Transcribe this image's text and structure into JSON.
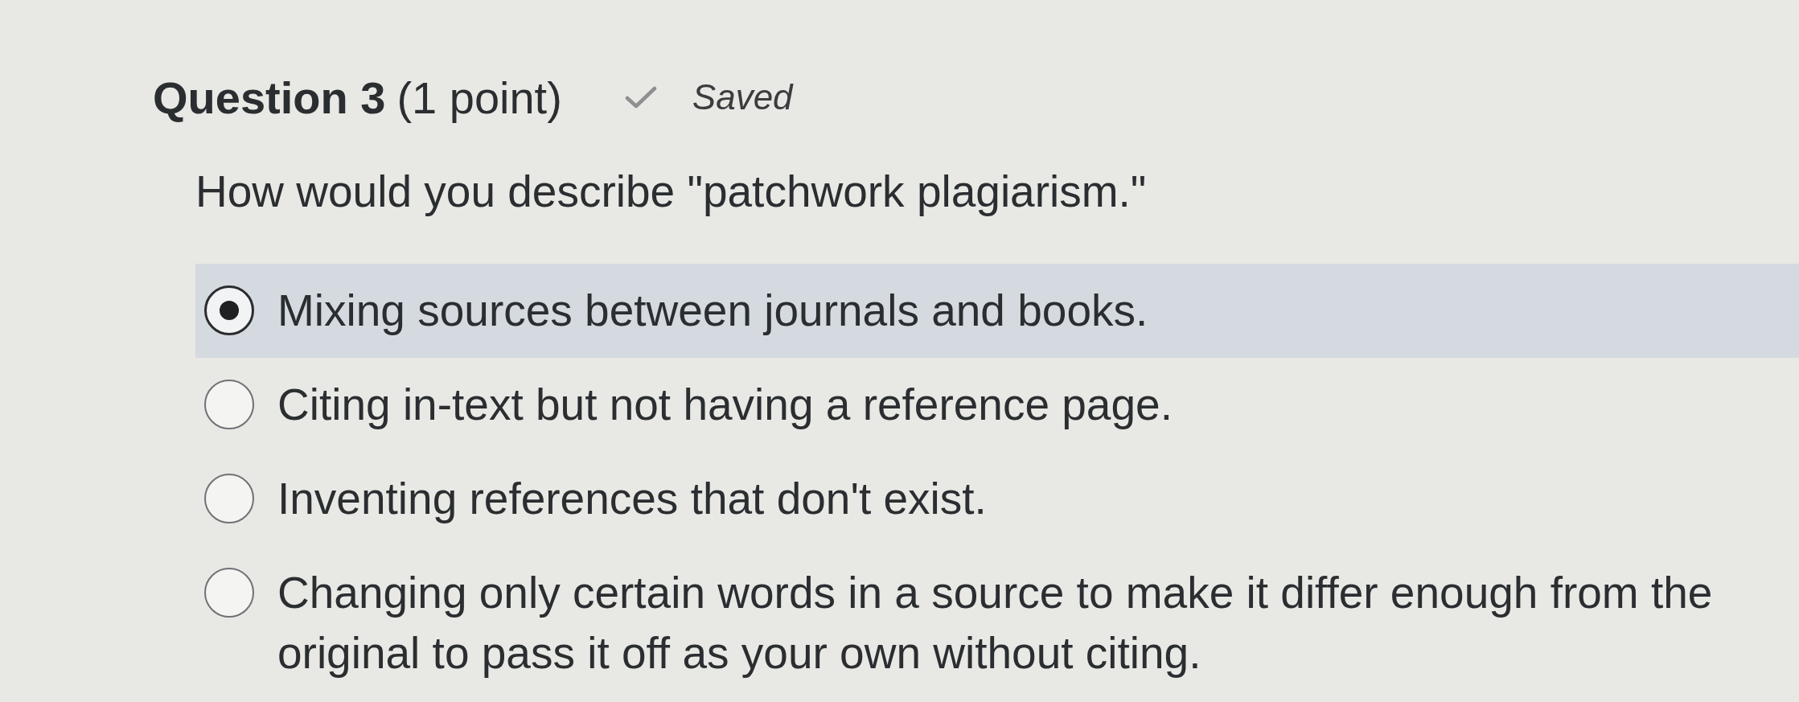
{
  "question": {
    "title": "Question 3",
    "points": "(1 point)",
    "save_status": {
      "label": "Saved"
    },
    "prompt": "How would you describe \"patchwork plagiarism.\""
  },
  "options": [
    {
      "label": "Mixing sources between journals and books.",
      "selected": true
    },
    {
      "label": "Citing in-text but not having a reference page.",
      "selected": false
    },
    {
      "label": "Inventing references that don't exist.",
      "selected": false
    },
    {
      "label": "Changing only certain words in a source to make it differ enough from the original to pass it off as your own without citing.",
      "selected": false
    }
  ]
}
